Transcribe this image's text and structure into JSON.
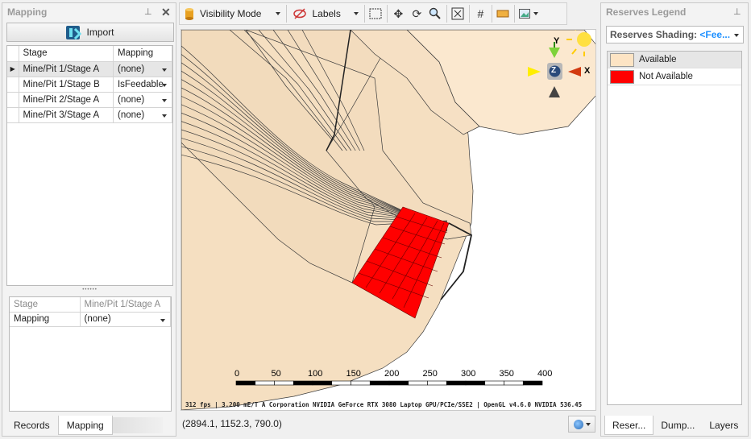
{
  "left_panel": {
    "title": "Mapping",
    "import_label": "Import",
    "columns": [
      "Stage",
      "Mapping"
    ],
    "rows": [
      {
        "stage": "Mine/Pit 1/Stage A",
        "mapping": "(none)"
      },
      {
        "stage": "Mine/Pit 1/Stage B",
        "mapping": "IsFeedable"
      },
      {
        "stage": "Mine/Pit 2/Stage A",
        "mapping": "(none)"
      },
      {
        "stage": "Mine/Pit 3/Stage A",
        "mapping": "(none)"
      }
    ],
    "detail": {
      "stage_label": "Stage",
      "stage_value": "Mine/Pit 1/Stage A",
      "mapping_label": "Mapping",
      "mapping_value": "(none)"
    },
    "tabs": [
      "Records",
      "Mapping"
    ]
  },
  "toolbar": {
    "visibility_label": "Visibility Mode",
    "labels_label": "Labels"
  },
  "viewport": {
    "axes": {
      "y": "Y",
      "z": "Z",
      "x": "X"
    },
    "scale_ticks": [
      "0",
      "50",
      "100",
      "150",
      "200",
      "250",
      "300",
      "350",
      "400"
    ],
    "status_line": "312 fps | 3.200 mE/T A Corporation NVIDIA GeForce RTX 3080 Laptop GPU/PCIe/SSE2 | OpenGL v4.6.0 NVIDIA 536.45"
  },
  "coordinates": "(2894.1, 1152.3, 790.0)",
  "right_panel": {
    "title": "Reserves Legend",
    "shading_label": "Reserves Shading:",
    "shading_value": "<Fee...",
    "legend": [
      {
        "label": "Available",
        "color": "#fde4c4"
      },
      {
        "label": "Not Available",
        "color": "#ff0000"
      }
    ],
    "tabs": [
      "Reser...",
      "Dump...",
      "Layers"
    ]
  },
  "colors": {
    "block_fill": "#f5dfc1",
    "not_available": "#ff0000",
    "block_line": "#3a3a3a"
  }
}
